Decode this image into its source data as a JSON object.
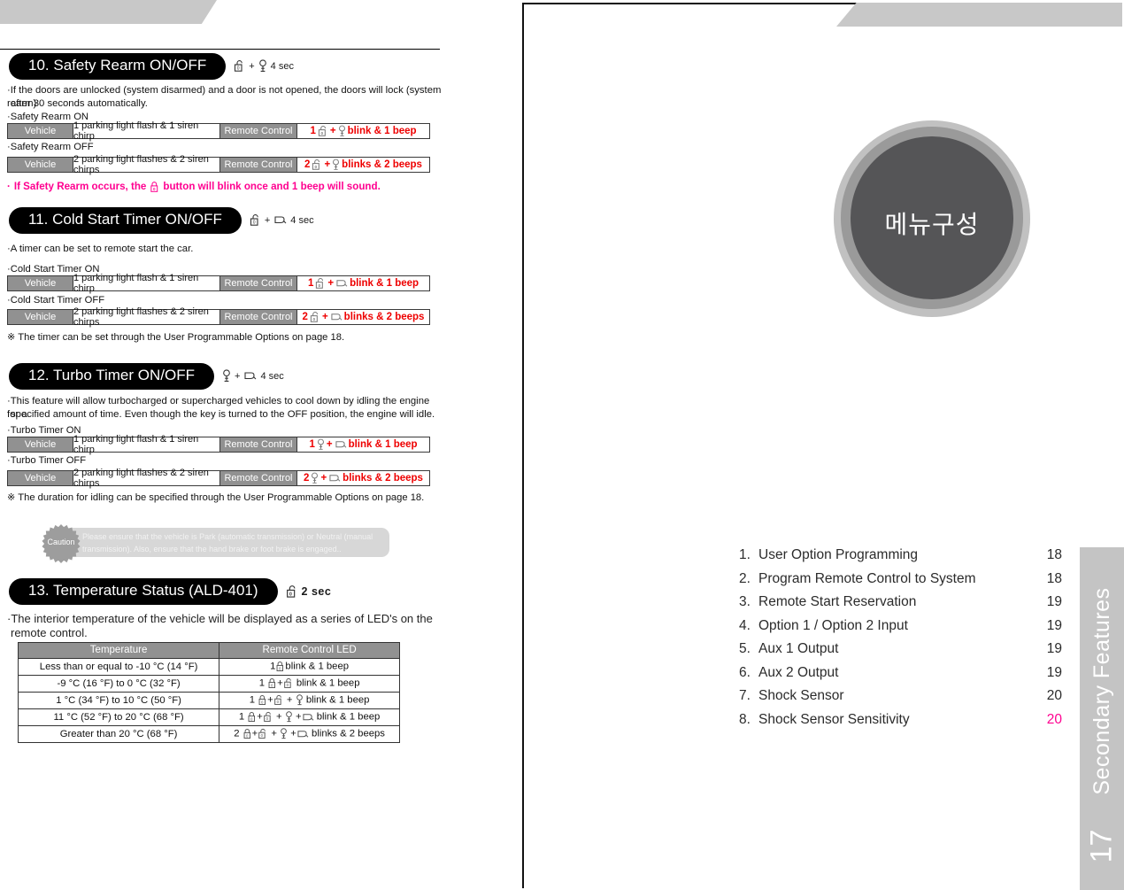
{
  "left_page": {
    "sections": [
      {
        "pill": "10. Safety Rearm ON/OFF",
        "trigger_icons": [
          "unlock-icon",
          "key-icon"
        ],
        "trigger_text": "4 sec",
        "body": "If the doors are unlocked (system disarmed) and a door is not opened, the doors will lock (system rearm)",
        "body2": "after 30 seconds automatically.",
        "on_label": "Safety Rearm ON",
        "off_label": "Safety Rearm OFF",
        "on_row": {
          "vehicle": "Vehicle",
          "vehicle_desc": "1 parking light flash & 1 siren chirp",
          "remote": "Remote Control",
          "result_count": "1",
          "result_text": "blink & 1 beep",
          "result_icons": [
            "unlock-icon",
            "key-icon"
          ]
        },
        "off_row": {
          "vehicle": "Vehicle",
          "vehicle_desc": "2 parking light flashes & 2 siren chirps",
          "remote": "Remote Control",
          "result_count": "2",
          "result_text": "blinks & 2 beeps",
          "result_icons": [
            "unlock-icon",
            "key-icon"
          ]
        },
        "footnote": "If Safety Rearm occurs, the",
        "footnote2": "button will blink once and 1 beep will sound."
      },
      {
        "pill": "11. Cold Start Timer ON/OFF",
        "trigger_icons": [
          "unlock-icon",
          "remote-start-icon"
        ],
        "trigger_text": "4 sec",
        "body": "A timer can be set to remote start the car.",
        "on_label": "Cold Start Timer ON",
        "off_label": "Cold Start Timer OFF",
        "on_row": {
          "vehicle": "Vehicle",
          "vehicle_desc": "1 parking light flash & 1 siren chirp",
          "remote": "Remote Control",
          "result_count": "1",
          "result_text": "blink & 1 beep",
          "result_icons": [
            "unlock-icon",
            "remote-start-icon"
          ]
        },
        "off_row": {
          "vehicle": "Vehicle",
          "vehicle_desc": "2 parking light flashes & 2 siren chirps",
          "remote": "Remote Control",
          "result_count": "2",
          "result_text": "blinks & 2 beeps",
          "result_icons": [
            "unlock-icon",
            "remote-start-icon"
          ]
        },
        "note": "※ The timer can be set through the User Programmable Options on page 18."
      },
      {
        "pill": "12. Turbo Timer ON/OFF",
        "trigger_icons": [
          "key-icon",
          "remote-start-icon"
        ],
        "trigger_text": "4 sec",
        "body": "This feature will allow turbocharged or supercharged vehicles to cool down by idling the engine for a",
        "body2": "specified amount of time.  Even though the key is turned to the OFF position, the engine will idle.",
        "on_label": "Turbo Timer ON",
        "off_label": "Turbo Timer OFF",
        "on_row": {
          "vehicle": "Vehicle",
          "vehicle_desc": "1 parking light flash & 1 siren chirp",
          "remote": "Remote Control",
          "result_count": "1",
          "result_text": "blink & 1 beep",
          "result_icons": [
            "key-icon",
            "remote-start-icon"
          ]
        },
        "off_row": {
          "vehicle": "Vehicle",
          "vehicle_desc": "2 parking light flashes & 2 siren chirps",
          "remote": "Remote Control",
          "result_count": "2",
          "result_text": "blinks & 2 beeps",
          "result_icons": [
            "key-icon",
            "remote-start-icon"
          ]
        },
        "note": "※ The duration for idling can be specified through the User Programmable Options on page 18."
      },
      {
        "pill": "13. Temperature Status (ALD-401)",
        "trigger_icons": [
          "unlock-icon"
        ],
        "trigger_text": "2 sec",
        "body": "The interior temperature of the vehicle will be displayed as a series of LED's on the",
        "body2": "remote control."
      }
    ],
    "caution": {
      "badge_label": "Caution",
      "line1": "Please ensure that the vehicle is Park (automatic transmission) or Neutral (manual",
      "line2": "transmission).  Also, ensure that the hand brake or foot brake is engaged.."
    },
    "temperature_table": {
      "headers": [
        "Temperature",
        "Remote Control LED"
      ],
      "rows": [
        {
          "temperature": "Less than or equal to -10 °C (14 °F)",
          "count": "1",
          "icons": [
            "lock-icon"
          ],
          "led": "blink & 1 beep"
        },
        {
          "temperature": "-9 °C (16 °F) to 0 °C (32 °F)",
          "count": "1",
          "icons": [
            "lock-icon",
            "unlock-icon"
          ],
          "led": "blink & 1 beep"
        },
        {
          "temperature": "1 °C (34 °F) to 10 °C (50 °F)",
          "count": "1",
          "icons": [
            "lock-icon",
            "unlock-icon",
            "key-icon"
          ],
          "led": "blink & 1 beep"
        },
        {
          "temperature": "11 °C (52 °F) to 20 °C (68 °F)",
          "count": "1",
          "icons": [
            "lock-icon",
            "unlock-icon",
            "key-icon",
            "remote-start-icon"
          ],
          "led": "blink & 1 beep"
        },
        {
          "temperature": "Greater than 20 °C (68 °F)",
          "count": "2",
          "icons": [
            "lock-icon",
            "unlock-icon",
            "key-icon",
            "remote-start-icon"
          ],
          "led": "blinks & 2 beeps"
        }
      ]
    }
  },
  "right_page": {
    "blob_label": "메뉴구성",
    "contents": [
      {
        "num": "1.",
        "label": "User Option Programming",
        "page": "18",
        "highlight": false
      },
      {
        "num": "2.",
        "label": "Program Remote Control to System",
        "page": "18",
        "highlight": false
      },
      {
        "num": "3.",
        "label": "Remote Start Reservation",
        "page": "19",
        "highlight": false
      },
      {
        "num": "4.",
        "label": "Option 1 / Option 2 Input",
        "page": "19",
        "highlight": false
      },
      {
        "num": "5.",
        "label": "Aux 1 Output",
        "page": "19",
        "highlight": false
      },
      {
        "num": "6.",
        "label": "Aux 2 Output",
        "page": "19",
        "highlight": false
      },
      {
        "num": "7.",
        "label": "Shock Sensor",
        "page": "20",
        "highlight": false
      },
      {
        "num": "8.",
        "label": "Shock Sensor Sensitivity",
        "page": "20",
        "highlight": true
      }
    ],
    "side_tab": {
      "title": "Secondary Features",
      "page_number": "17"
    }
  },
  "colors": {
    "pill_bg": "#000000",
    "header_gray": "#919191",
    "accent_red": "#ee0000",
    "accent_pink": "#ff0090",
    "band_gray": "#c8c8c8",
    "tab_gray": "#c4c4c4"
  }
}
